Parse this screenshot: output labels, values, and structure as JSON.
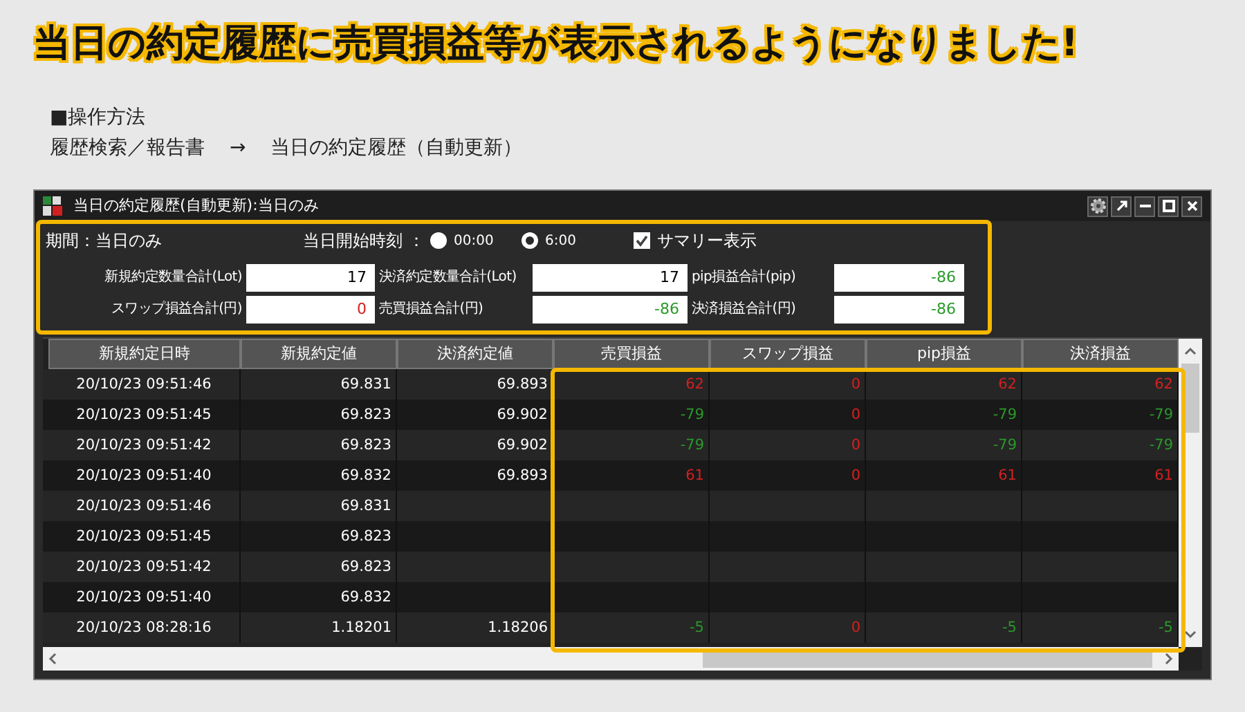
{
  "headline": "当日の約定履歴に売買損益等が表示されるようになりました!",
  "instructions": {
    "heading": "■操作方法",
    "path": [
      "履歴検索／報告書",
      "→",
      "当日の約定履歴（自動更新）"
    ]
  },
  "window": {
    "title": "当日の約定履歴(自動更新):当日のみ",
    "summary": {
      "period": "期間：当日のみ",
      "start_time_label": "当日開始時刻 ：",
      "start_times": [
        {
          "label": "00:00",
          "selected": false
        },
        {
          "label": "6:00",
          "selected": true
        }
      ],
      "show_summary": {
        "label": "サマリー表示",
        "checked": true
      },
      "fields": [
        {
          "label": "新規約定数量合計(Lot)",
          "value": "17",
          "color": "#000000"
        },
        {
          "label": "決済約定数量合計(Lot)",
          "value": "17",
          "color": "#000000"
        },
        {
          "label": "pip損益合計(pip)",
          "value": "-86",
          "color": "#2a9a2a"
        },
        {
          "label": "スワップ損益合計(円)",
          "value": "0",
          "color": "#d42020"
        },
        {
          "label": "売買損益合計(円)",
          "value": "-86",
          "color": "#2a9a2a"
        },
        {
          "label": "決済損益合計(円)",
          "value": "-86",
          "color": "#2a9a2a"
        }
      ]
    },
    "table": {
      "columns": [
        "新規約定日時",
        "新規約定値",
        "決済約定値",
        "売買損益",
        "スワップ損益",
        "pip損益",
        "決済損益"
      ],
      "rows": [
        {
          "cells": [
            "20/10/23 09:51:46",
            "69.831",
            "69.893",
            {
              "text": "62",
              "color": "#d42020"
            },
            {
              "text": "0",
              "color": "#d42020"
            },
            {
              "text": "62",
              "color": "#d42020"
            },
            {
              "text": "62",
              "color": "#d42020"
            }
          ]
        },
        {
          "cells": [
            "20/10/23 09:51:45",
            "69.823",
            "69.902",
            {
              "text": "-79",
              "color": "#2a9a2a"
            },
            {
              "text": "0",
              "color": "#d42020"
            },
            {
              "text": "-79",
              "color": "#2a9a2a"
            },
            {
              "text": "-79",
              "color": "#2a9a2a"
            }
          ]
        },
        {
          "cells": [
            "20/10/23 09:51:42",
            "69.823",
            "69.902",
            {
              "text": "-79",
              "color": "#2a9a2a"
            },
            {
              "text": "0",
              "color": "#d42020"
            },
            {
              "text": "-79",
              "color": "#2a9a2a"
            },
            {
              "text": "-79",
              "color": "#2a9a2a"
            }
          ]
        },
        {
          "cells": [
            "20/10/23 09:51:40",
            "69.832",
            "69.893",
            {
              "text": "61",
              "color": "#d42020"
            },
            {
              "text": "0",
              "color": "#d42020"
            },
            {
              "text": "61",
              "color": "#d42020"
            },
            {
              "text": "61",
              "color": "#d42020"
            }
          ]
        },
        {
          "cells": [
            "20/10/23 09:51:46",
            "69.831"
          ]
        },
        {
          "cells": [
            "20/10/23 09:51:45",
            "69.823"
          ]
        },
        {
          "cells": [
            "20/10/23 09:51:42",
            "69.823"
          ]
        },
        {
          "cells": [
            "20/10/23 09:51:40",
            "69.832"
          ]
        },
        {
          "cells": [
            "20/10/23 08:28:16",
            "1.18201",
            "1.18206",
            {
              "text": "-5",
              "color": "#2a9a2a"
            },
            {
              "text": "0",
              "color": "#d42020"
            },
            {
              "text": "-5",
              "color": "#2a9a2a"
            },
            {
              "text": "-5",
              "color": "#2a9a2a"
            }
          ]
        }
      ]
    }
  }
}
